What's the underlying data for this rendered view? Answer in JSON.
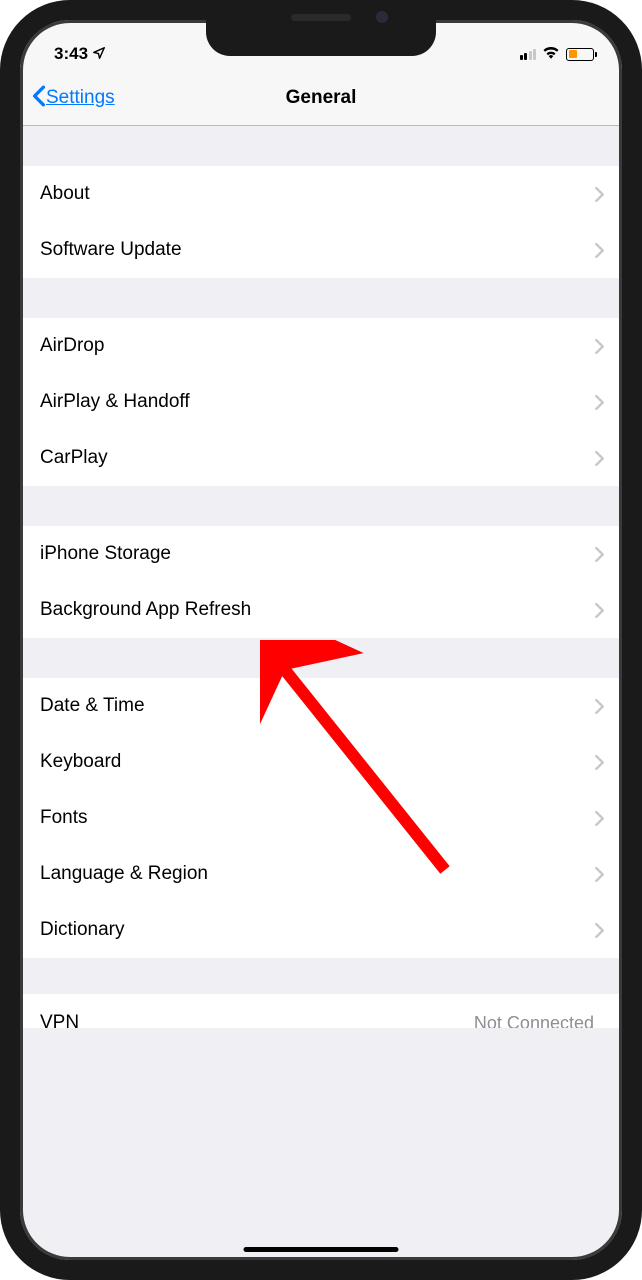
{
  "status_bar": {
    "time": "3:43",
    "location_icon": "navigation-arrow"
  },
  "nav": {
    "back_label": "Settings",
    "title": "General"
  },
  "groups": [
    {
      "items": [
        {
          "label": "About"
        },
        {
          "label": "Software Update"
        }
      ]
    },
    {
      "items": [
        {
          "label": "AirDrop"
        },
        {
          "label": "AirPlay & Handoff"
        },
        {
          "label": "CarPlay"
        }
      ]
    },
    {
      "items": [
        {
          "label": "iPhone Storage"
        },
        {
          "label": "Background App Refresh"
        }
      ]
    },
    {
      "items": [
        {
          "label": "Date & Time"
        },
        {
          "label": "Keyboard"
        },
        {
          "label": "Fonts"
        },
        {
          "label": "Language & Region"
        },
        {
          "label": "Dictionary"
        }
      ]
    }
  ],
  "cutoff_row": {
    "label": "VPN",
    "detail": "Not Connected"
  }
}
